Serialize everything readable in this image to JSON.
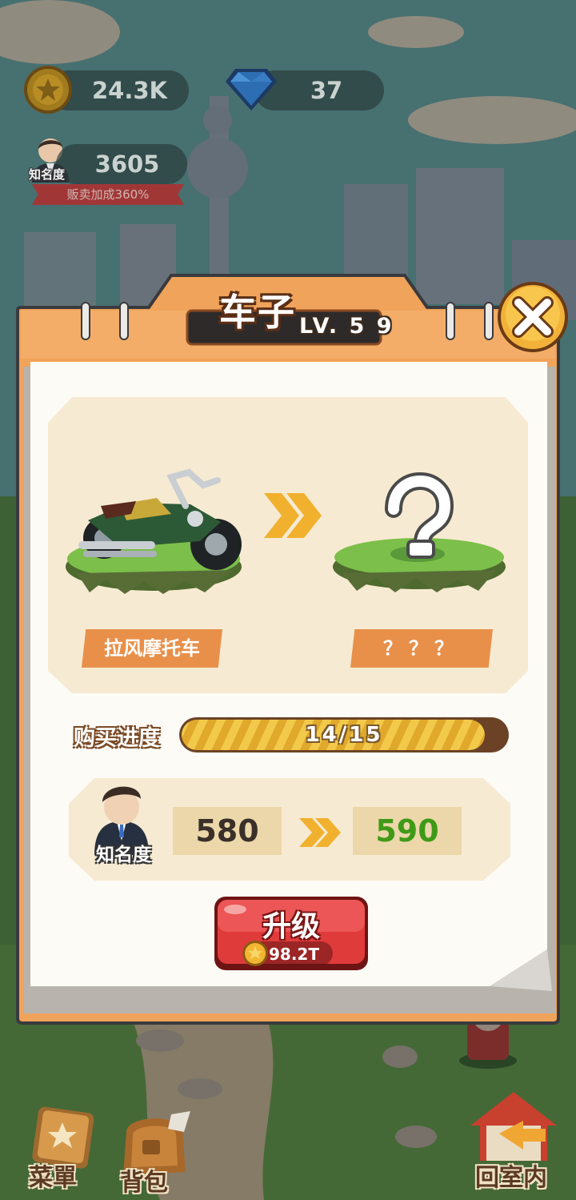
{
  "hud": {
    "coins": "24.3K",
    "gems": "37",
    "fame_value": "3605",
    "fame_tag": "知名度",
    "sell_bonus": "贩卖加成360%"
  },
  "dialog": {
    "title": "车子",
    "level": "LV. 5 9",
    "current_item": "拉风摩托车",
    "next_item": "？？？",
    "progress_label": "购买进度",
    "progress": {
      "current": 14,
      "total": 15,
      "text": "14/15"
    },
    "fame_label": "知名度",
    "fame_current": "580",
    "fame_next": "590",
    "upgrade_label": "升级",
    "upgrade_cost": "98.2T"
  },
  "nav": {
    "menu": "菜單",
    "bag": "背包",
    "room": "回室内"
  },
  "colors": {
    "panel_orange": "#f0a35a",
    "card_cream": "#f7ead2",
    "upgrade_red": "#e03b3b",
    "fame_next_green": "#3f9a17"
  }
}
